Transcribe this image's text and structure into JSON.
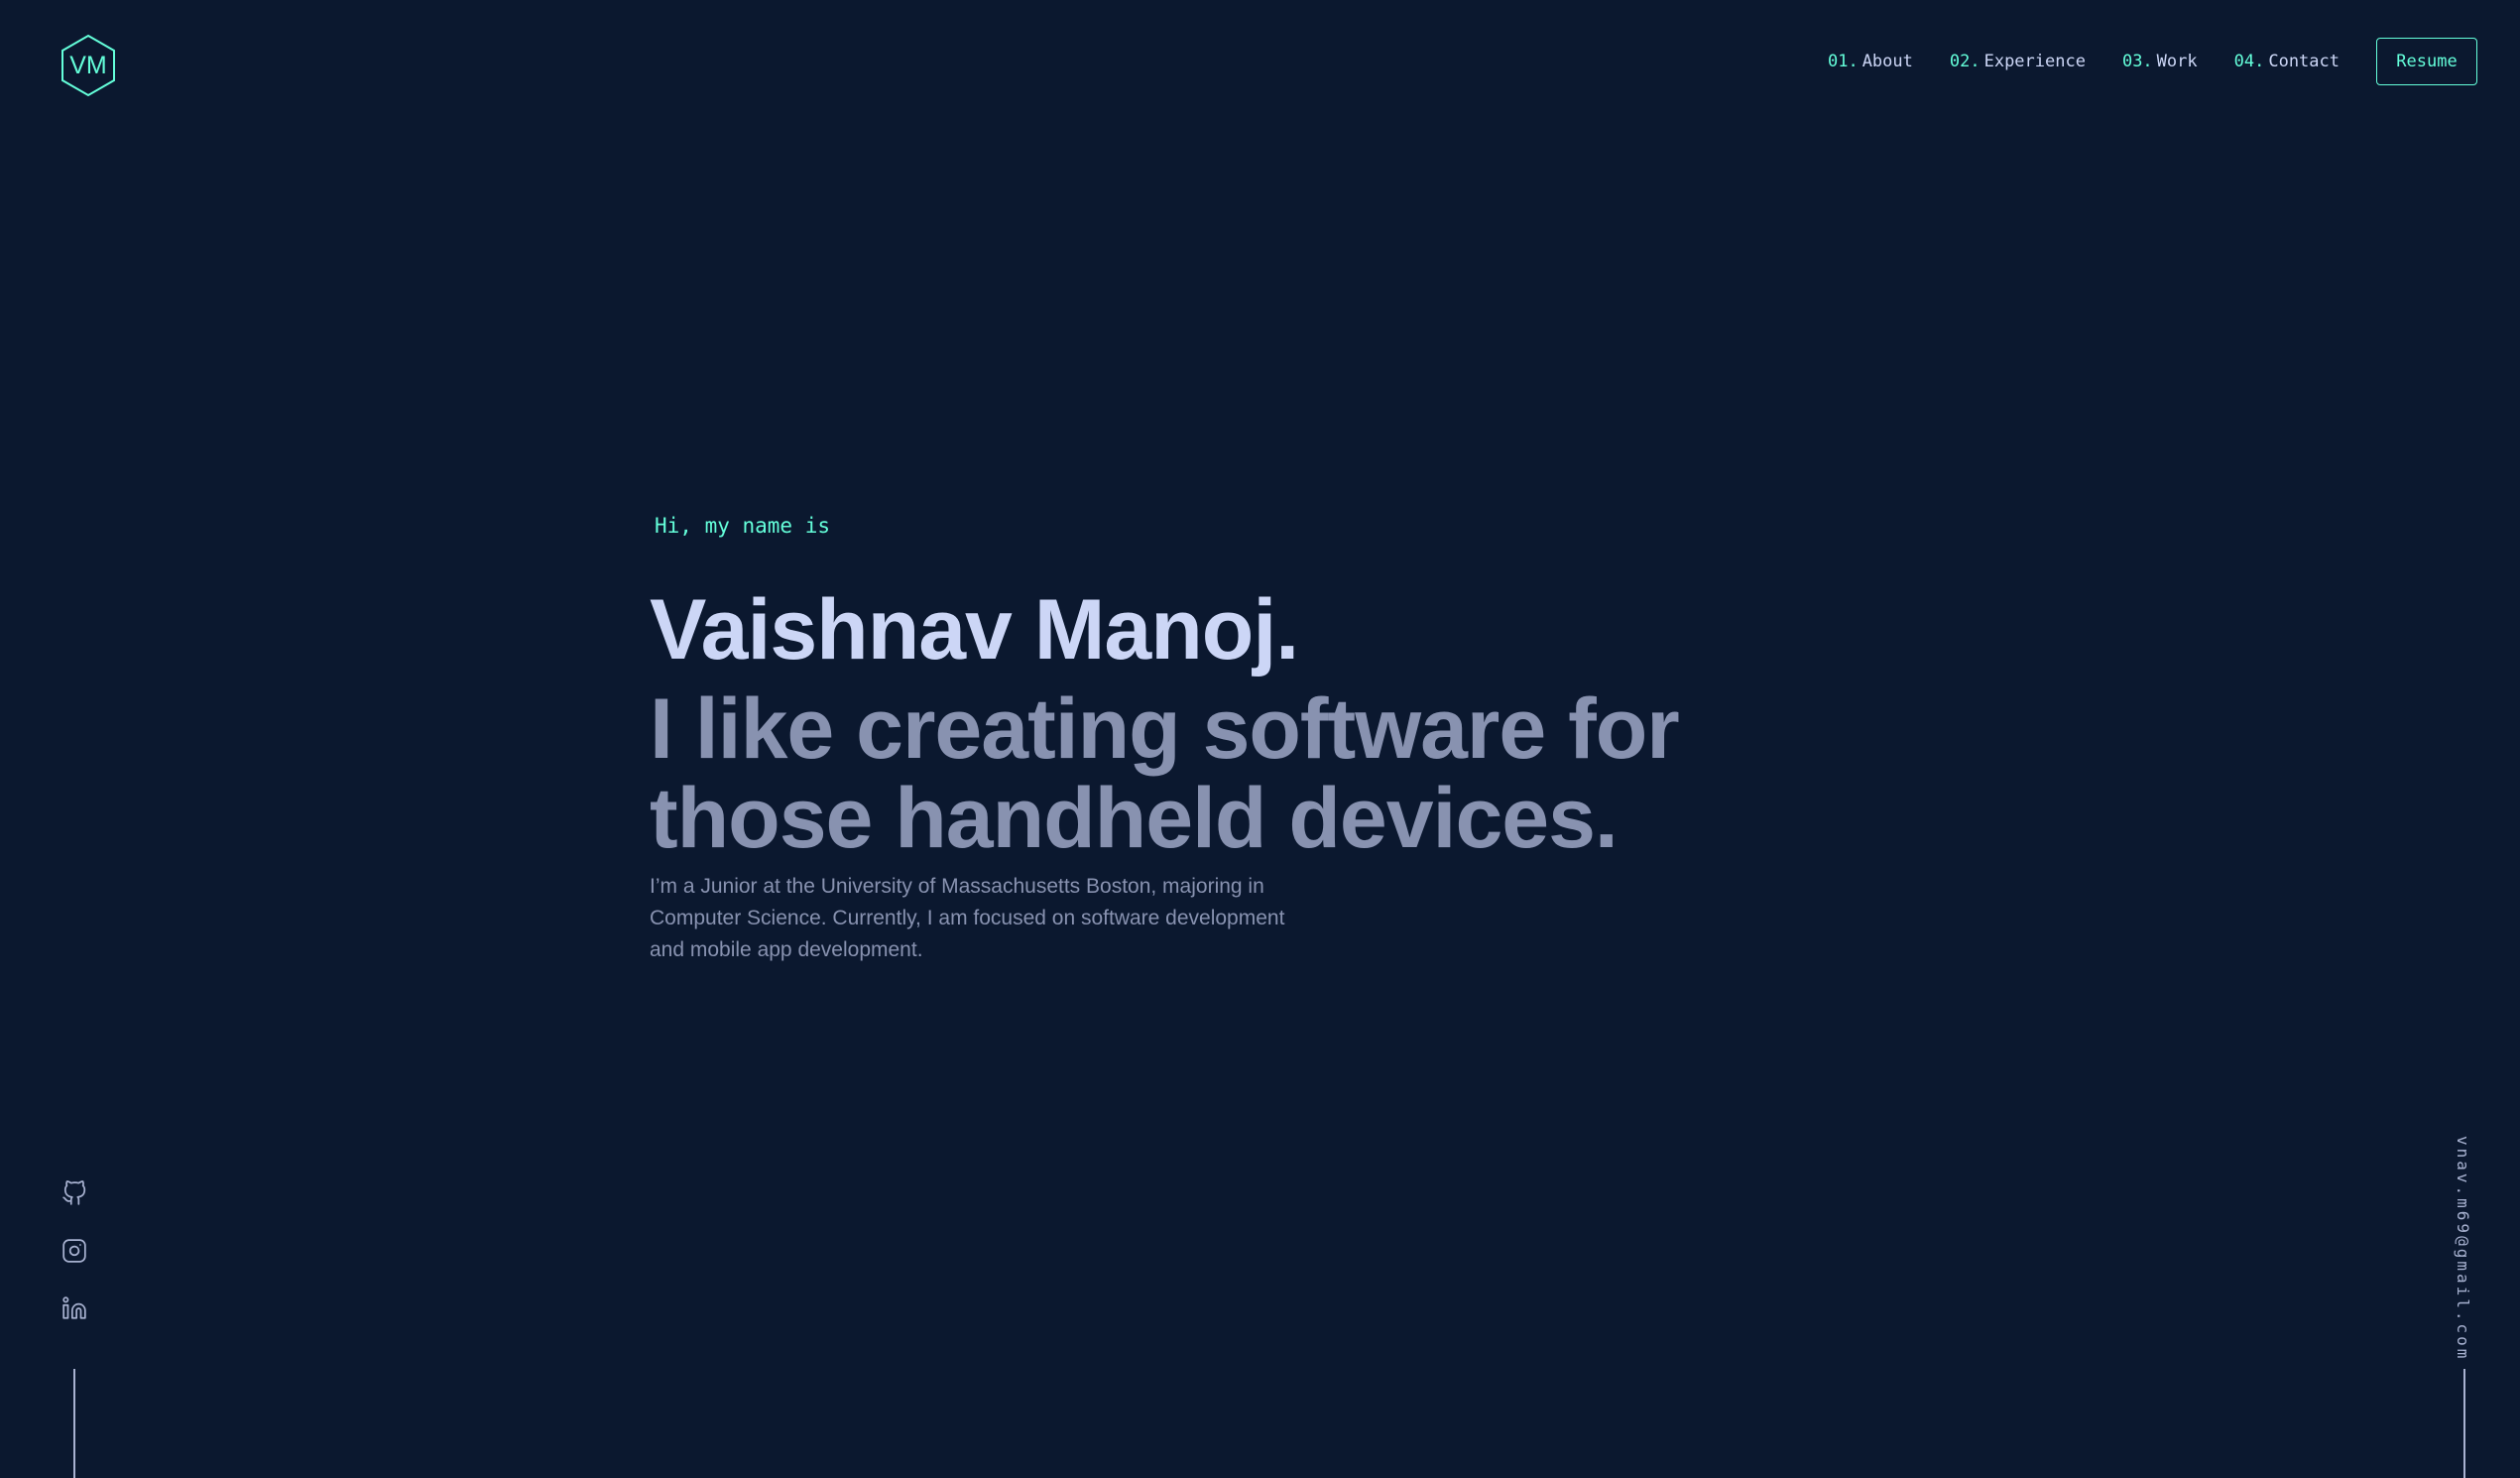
{
  "logo": {
    "initials": "VM",
    "icon": "hexagon-logo-icon",
    "accent": "#64ffda"
  },
  "nav": {
    "items": [
      {
        "num": "01.",
        "label": "About"
      },
      {
        "num": "02.",
        "label": "Experience"
      },
      {
        "num": "03.",
        "label": "Work"
      },
      {
        "num": "04.",
        "label": "Contact"
      }
    ],
    "resume_label": "Resume"
  },
  "hero": {
    "greeting": "Hi, my name is",
    "name": "Vaishnav Manoj.",
    "tagline": "I like creating software for those handheld devices.",
    "bio": "I’m a Junior at the University of Massachusetts Boston, majoring in Computer Science. Currently, I am focused on software development and mobile app development."
  },
  "social": {
    "icons": [
      "github-icon",
      "instagram-icon",
      "linkedin-icon"
    ]
  },
  "email": "vnav.m69@gmail.com",
  "colors": {
    "background": "#0b182f",
    "accent": "#64ffda",
    "heading": "#ccd6f6",
    "body_text": "#8892b0"
  }
}
